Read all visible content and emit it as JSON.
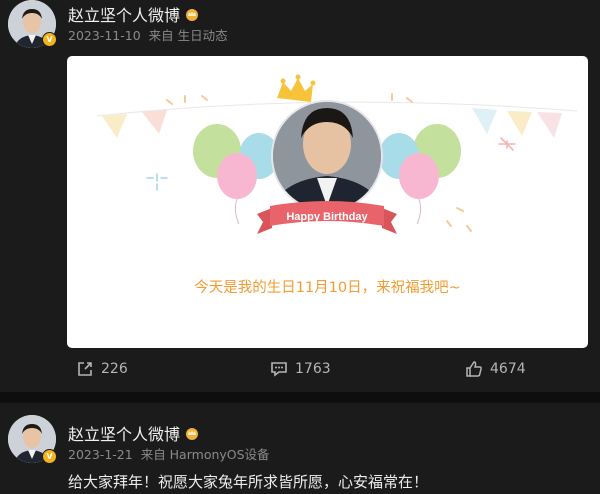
{
  "posts": [
    {
      "author": "赵立坚个人微博",
      "date": "2023-11-10",
      "source": "来自 生日动态",
      "card": {
        "banner": "Happy Birthday",
        "message": "今天是我的生日11月10日，来祝福我吧~"
      },
      "actions": {
        "share": "226",
        "comment": "1763",
        "like": "4674"
      }
    },
    {
      "author": "赵立坚个人微博",
      "date": "2023-1-21",
      "source": "来自 HarmonyOS设备",
      "text": "给大家拜年！祝愿大家兔年所求皆所愿，心安福常在！"
    }
  ],
  "verified_badge": "V",
  "colors": {
    "background": "#1b1b1b",
    "card_text": "#f39c33",
    "banner": "#e8646a",
    "badge": "#f6b21a"
  }
}
